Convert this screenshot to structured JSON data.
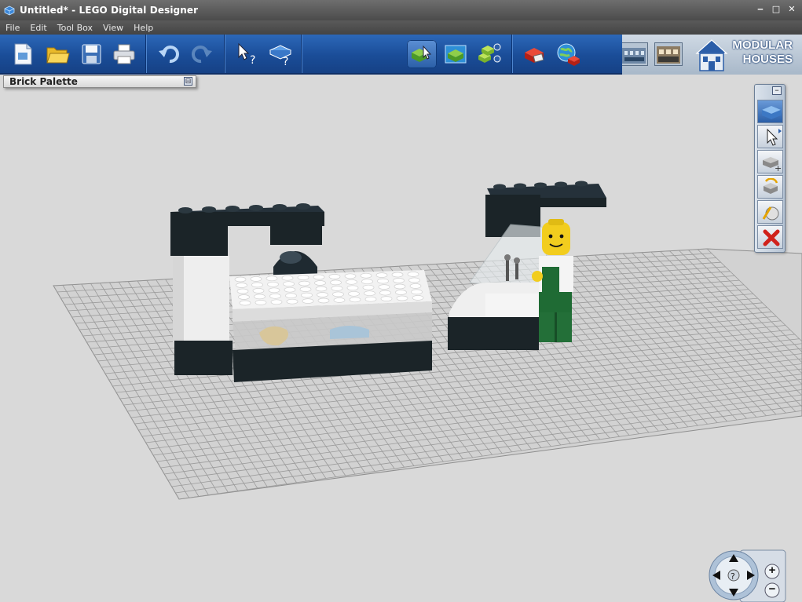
{
  "window": {
    "title": "Untitled* - LEGO Digital Designer",
    "controls": [
      "‒",
      "□",
      "✕"
    ]
  },
  "menu": [
    "File",
    "Edit",
    "Tool Box",
    "View",
    "Help"
  ],
  "toolbar": {
    "groups": [
      {
        "name": "file",
        "buttons": [
          "new-file-icon",
          "open-folder-icon",
          "save-icon",
          "print-icon"
        ]
      },
      {
        "name": "history",
        "buttons": [
          "undo-icon",
          "redo-icon"
        ]
      },
      {
        "name": "help",
        "buttons": [
          "select-help-icon",
          "brick-help-icon"
        ]
      },
      {
        "name": "modes",
        "buttons": [
          "build-mode-icon",
          "view-mode-icon",
          "building-guide-icon"
        ],
        "active": "build-mode-icon"
      },
      {
        "name": "share",
        "buttons": [
          "order-bricks-icon",
          "share-online-icon"
        ]
      }
    ],
    "theme": {
      "line1": "MODULAR",
      "line2": "HOUSES"
    }
  },
  "brick_palette": {
    "label": "Brick Palette"
  },
  "toolbox": {
    "tools": [
      "brick-icon",
      "select-arrow-icon",
      "clone-icon",
      "hinge-icon",
      "paint-icon",
      "delete-icon"
    ],
    "active": "brick-icon"
  },
  "navigation": {
    "zoom_in": "+",
    "zoom_out": "−"
  },
  "colors": {
    "toolbar_blue": "#1f57a5",
    "canvas": "#d9d9d9",
    "grid": "#8e8e8e",
    "brick_black": "#1b2428",
    "brick_white": "#f2f2f2",
    "minifig_yellow": "#f2cd1e",
    "minifig_green": "#1f6b34"
  }
}
